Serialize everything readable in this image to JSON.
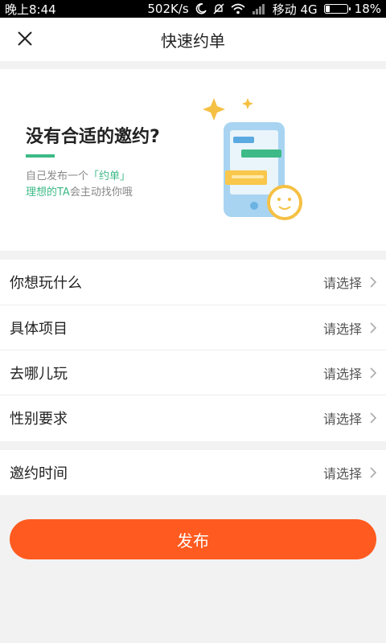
{
  "status_bar": {
    "time": "晚上8:44",
    "speed": "502K/s",
    "carrier": "移动 4G",
    "battery": "18%",
    "battery_level": 0.18
  },
  "header": {
    "title": "快速约单",
    "close_icon": "close-icon"
  },
  "banner": {
    "title": "没有合适的邀约?",
    "desc_line1_prefix": "自己发布一个",
    "desc_line1_accent": "「约单」",
    "desc_line2_accent": "理想的TA",
    "desc_line2_suffix": "会主动找你哦",
    "accent_color": "#3dba87"
  },
  "form": {
    "group1": [
      {
        "label": "你想玩什么",
        "value": "请选择"
      },
      {
        "label": "具体项目",
        "value": "请选择"
      },
      {
        "label": "去哪儿玩",
        "value": "请选择"
      },
      {
        "label": "性别要求",
        "value": "请选择"
      }
    ],
    "group2": [
      {
        "label": "邀约时间",
        "value": "请选择"
      }
    ]
  },
  "publish": {
    "label": "发布",
    "color": "#ff5a1f"
  }
}
